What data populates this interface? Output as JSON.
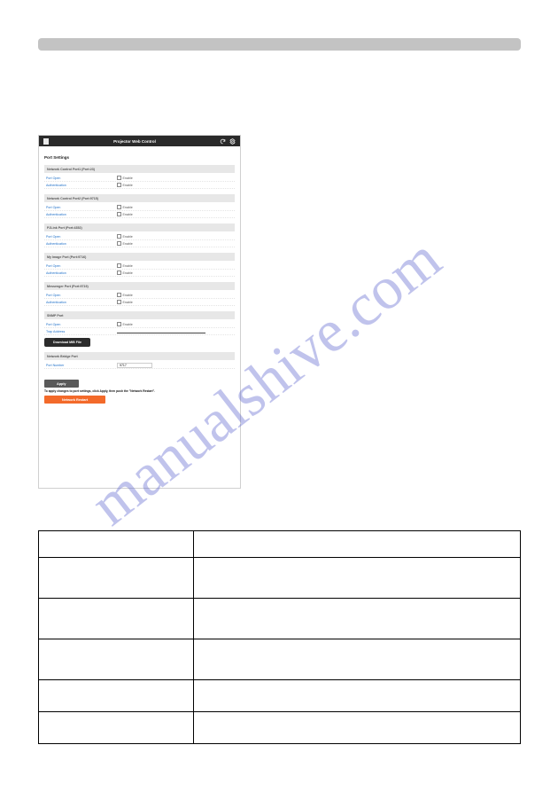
{
  "watermark": "manualshive.com",
  "header": {
    "title": "Projector Web Control"
  },
  "ios": {
    "enable": "Enable"
  },
  "page": {
    "heading": "Port Settings"
  },
  "sections": {
    "nc1": {
      "title": "Network Control Port1 (Port:23)",
      "row1": "Port Open",
      "row2": "Authentication"
    },
    "nc2": {
      "title": "Network Control Port2 (Port:9715)",
      "row1": "Port Open",
      "row2": "Authentication"
    },
    "pjl": {
      "title": "PJLink Port (Port:4352)",
      "row1": "Port Open",
      "row2": "Authentication"
    },
    "img": {
      "title": "My Image Port (Port:9716)",
      "row1": "Port Open",
      "row2": "Authentication"
    },
    "msg": {
      "title": "Messenger Port (Port:9719)",
      "row1": "Port Open",
      "row2": "Authentication"
    },
    "snmp": {
      "title": "SNMP Port",
      "row1": "Port Open",
      "row2": "Trap Address",
      "download": "Download MIB File"
    },
    "bridge": {
      "title": "Network Bridge Port",
      "row1": "Port Number",
      "port_value": "9717"
    }
  },
  "footer": {
    "apply": "Apply",
    "note": "To apply changes to port settings, click Apply, then push the \"Network Restart\".",
    "restart": "Network Restart"
  }
}
